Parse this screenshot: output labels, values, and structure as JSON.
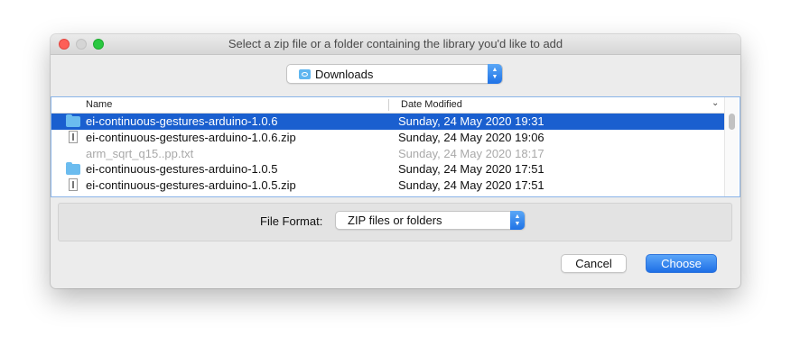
{
  "window": {
    "title": "Select a zip file or a folder containing the library you'd like to add"
  },
  "location": {
    "label": "Downloads",
    "icon": "downloads-folder-icon"
  },
  "columns": {
    "name": "Name",
    "date": "Date Modified"
  },
  "files": [
    {
      "name": "ei-continuous-gestures-arduino-1.0.6",
      "date": "Sunday, 24 May 2020 19:31",
      "kind": "folder",
      "state": "selected"
    },
    {
      "name": "ei-continuous-gestures-arduino-1.0.6.zip",
      "date": "Sunday, 24 May 2020 19:06",
      "kind": "zip",
      "state": "normal"
    },
    {
      "name": "arm_sqrt_q15..pp.txt",
      "date": "Sunday, 24 May 2020 18:17",
      "kind": "text",
      "state": "disabled"
    },
    {
      "name": "ei-continuous-gestures-arduino-1.0.5",
      "date": "Sunday, 24 May 2020 17:51",
      "kind": "folder",
      "state": "normal"
    },
    {
      "name": "ei-continuous-gestures-arduino-1.0.5.zip",
      "date": "Sunday, 24 May 2020 17:51",
      "kind": "zip",
      "state": "normal"
    }
  ],
  "format": {
    "label": "File Format:",
    "value": "ZIP files or folders"
  },
  "buttons": {
    "cancel": "Cancel",
    "choose": "Choose"
  },
  "colors": {
    "selection": "#1a5fcf",
    "accent": "#1e6fe6",
    "close": "#fd5f57",
    "zoom": "#2ac840"
  }
}
